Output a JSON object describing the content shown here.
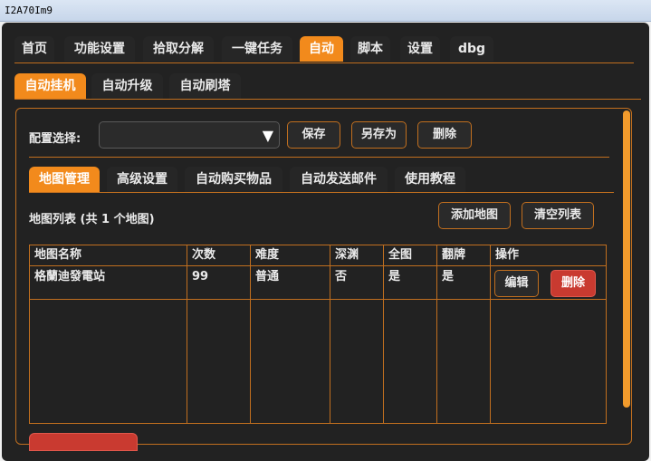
{
  "window": {
    "title": "I2A70Im9"
  },
  "main_tabs": [
    {
      "label": "首页",
      "active": false
    },
    {
      "label": "功能设置",
      "active": false
    },
    {
      "label": "拾取分解",
      "active": false
    },
    {
      "label": "一键任务",
      "active": false
    },
    {
      "label": "自动",
      "active": true
    },
    {
      "label": "脚本",
      "active": false
    },
    {
      "label": "设置",
      "active": false
    },
    {
      "label": "dbg",
      "active": false
    }
  ],
  "sub_tabs": [
    {
      "label": "自动挂机",
      "active": true
    },
    {
      "label": "自动升级",
      "active": false
    },
    {
      "label": "自动刷塔",
      "active": false
    }
  ],
  "config": {
    "label": "配置选择:",
    "selected": "",
    "save_label": "保存",
    "save_as_label": "另存为",
    "delete_label": "删除"
  },
  "inner_tabs": [
    {
      "label": "地图管理",
      "active": true
    },
    {
      "label": "高级设置",
      "active": false
    },
    {
      "label": "自动购买物品",
      "active": false
    },
    {
      "label": "自动发送邮件",
      "active": false
    },
    {
      "label": "使用教程",
      "active": false
    }
  ],
  "map_list": {
    "title": "地图列表 (共 1 个地图)",
    "add_label": "添加地图",
    "clear_label": "清空列表",
    "columns": [
      "地图名称",
      "次数",
      "难度",
      "深渊",
      "全图",
      "翻牌",
      "操作"
    ],
    "rows": [
      {
        "name": "格蘭迪發電站",
        "count": "99",
        "difficulty": "普通",
        "abyss": "否",
        "fullmap": "是",
        "flip": "是",
        "edit_label": "编辑",
        "delete_label": "删除"
      }
    ]
  },
  "colors": {
    "accent": "#f28a1c",
    "border": "#c16f1f",
    "danger": "#c93a30",
    "background": "#222222"
  }
}
